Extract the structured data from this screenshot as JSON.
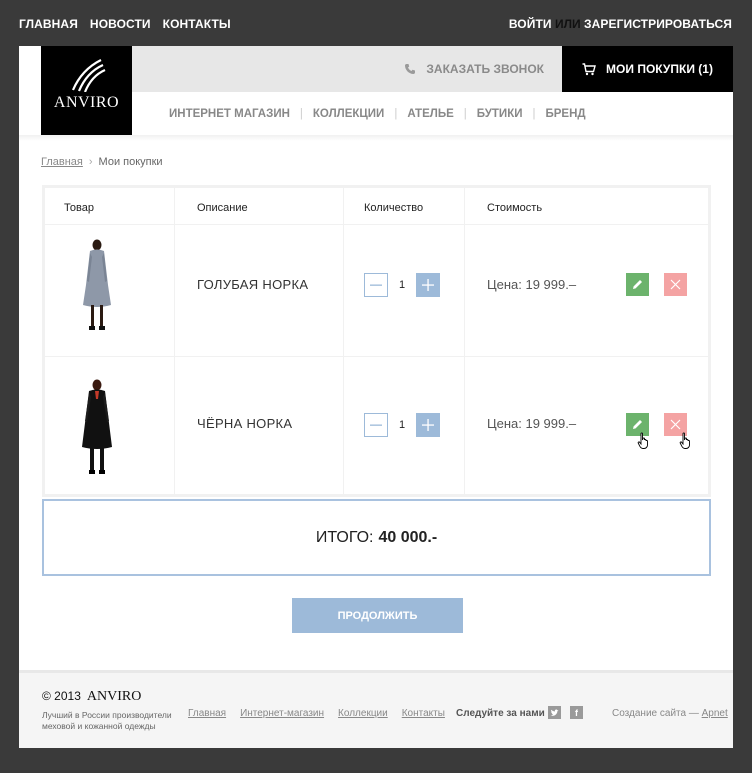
{
  "topnav": {
    "items": [
      "ГЛАВНАЯ",
      "НОВОСТИ",
      "КОНТАКТЫ"
    ],
    "login": "ВОЙТИ",
    "or": "ИЛИ",
    "register": "ЗАРЕГИСТРИРОВАТЬСЯ"
  },
  "header": {
    "logo_text": "ANVIRO",
    "call_label": "ЗАКАЗАТЬ ЗВОНОК",
    "cart_label": "МОИ ПОКУПКИ (1)",
    "nav": [
      "ИНТЕРНЕТ МАГАЗИН",
      "КОЛЛЕКЦИИ",
      "АТЕЛЬЕ",
      "БУТИКИ",
      "БРЕНД"
    ]
  },
  "breadcrumb": {
    "home": "Главная",
    "current": "Мои покупки"
  },
  "table": {
    "headers": [
      "Товар",
      "Описание",
      "Количество",
      "Стоимость"
    ],
    "rows": [
      {
        "description": "ГОЛУБАЯ НОРКА",
        "qty": "1",
        "price": "Цена: 19 999.–"
      },
      {
        "description": "ЧЁРНА НОРКА",
        "qty": "1",
        "price": "Цена: 19 999.–"
      }
    ]
  },
  "total": {
    "label": "ИТОГО:",
    "value": "40 000.-"
  },
  "continue_label": "ПРОДОЛЖИТЬ",
  "footer": {
    "copyright": "© 2013",
    "brand": "ANVIRO",
    "tagline": "Лучший в России производители меховой и кожанной одежды",
    "links": [
      "Главная",
      "Интернет-магазин",
      "Коллекции",
      "Контакты"
    ],
    "follow": "Следуйте за нами",
    "credit_prefix": "Создание сайта —",
    "credit_link": "Apnet"
  },
  "colors": {
    "accent_blue": "#9dbad9",
    "edit_green": "#6cb36c",
    "delete_red": "#f4a3a3",
    "black": "#000000"
  },
  "icons": [
    "phone-icon",
    "cart-icon",
    "minus-icon",
    "plus-icon",
    "pencil-icon",
    "close-icon",
    "twitter-icon",
    "facebook-icon",
    "hand-cursor-icon"
  ]
}
